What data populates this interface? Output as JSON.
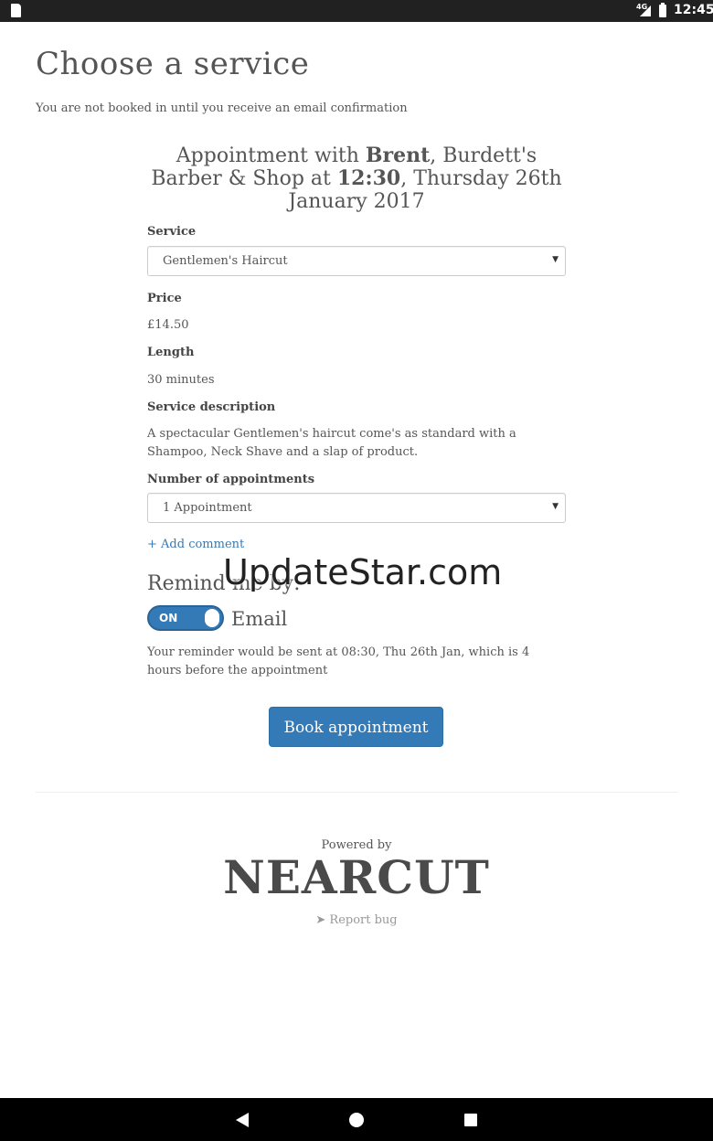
{
  "status_bar": {
    "network": "4G",
    "time": "12:45"
  },
  "page": {
    "title": "Choose a service",
    "notice": "You are not booked in until you receive an email confirmation"
  },
  "appointment": {
    "prefix": "Appointment with ",
    "barber": "Brent",
    "middle": ", Burdett's Barber & Shop at ",
    "time": "12:30",
    "date": ", Thursday 26th January 2017"
  },
  "form": {
    "service_label": "Service",
    "service_value": "Gentlemen's Haircut",
    "price_label": "Price",
    "price_value": "£14.50",
    "length_label": "Length",
    "length_value": "30 minutes",
    "description_label": "Service description",
    "description_value": "A spectacular Gentlemen's haircut come's as standard with a Shampoo, Neck Shave and a slap of product.",
    "appointments_label": "Number of appointments",
    "appointments_value": "1 Appointment",
    "add_comment": "+ Add comment",
    "remind_title": "Remind me by:",
    "toggle_state": "ON",
    "toggle_label": "Email",
    "reminder_note": "Your reminder would be sent at 08:30, Thu 26th Jan, which is 4 hours before the appointment"
  },
  "actions": {
    "book_label": "Book appointment"
  },
  "footer": {
    "powered_by": "Powered by",
    "logo_text": "NEARCUT",
    "report_bug": "Report bug"
  },
  "watermark": "UpdateStar.com",
  "colors": {
    "accent": "#337ab7",
    "status_bar": "#212121",
    "nav_bar": "#000000"
  }
}
